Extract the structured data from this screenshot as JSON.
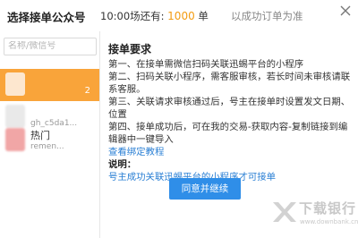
{
  "header": {
    "title": "选择接单公众号",
    "count_prefix": "10:00场还有:",
    "count_value": "1000",
    "count_unit": "单",
    "note": "以成功订单为准"
  },
  "sidebar": {
    "search_placeholder": "名称/微信号",
    "accounts": [
      {
        "name": "",
        "sub": "",
        "badge": "2"
      },
      {
        "name": "",
        "sub": "gh_c5da1..."
      },
      {
        "name": "热门",
        "sub": "remen..."
      }
    ]
  },
  "main": {
    "section_title": "接单要求",
    "rules": [
      "第一、在接单需微信扫码关联迅蜴平台的小程序",
      "第二、扫码关联小程序，需客服审核，若长时间未审核请联系客服。",
      "第三、关联请求审核通过后，号主在接单时设置发文日期、位置",
      "第四、接单成功后，可在我的交易-获取内容-复制链接到编辑器中一键导入"
    ],
    "view_tutorial": "查看绑定教程",
    "note_label": "说明：",
    "note_link": "号主成功关联迅蜴平台的小程序才可接单",
    "agree_button": "同意并继续"
  },
  "watermark": {
    "text": "下载银行",
    "url": "www.downbank.cn"
  }
}
